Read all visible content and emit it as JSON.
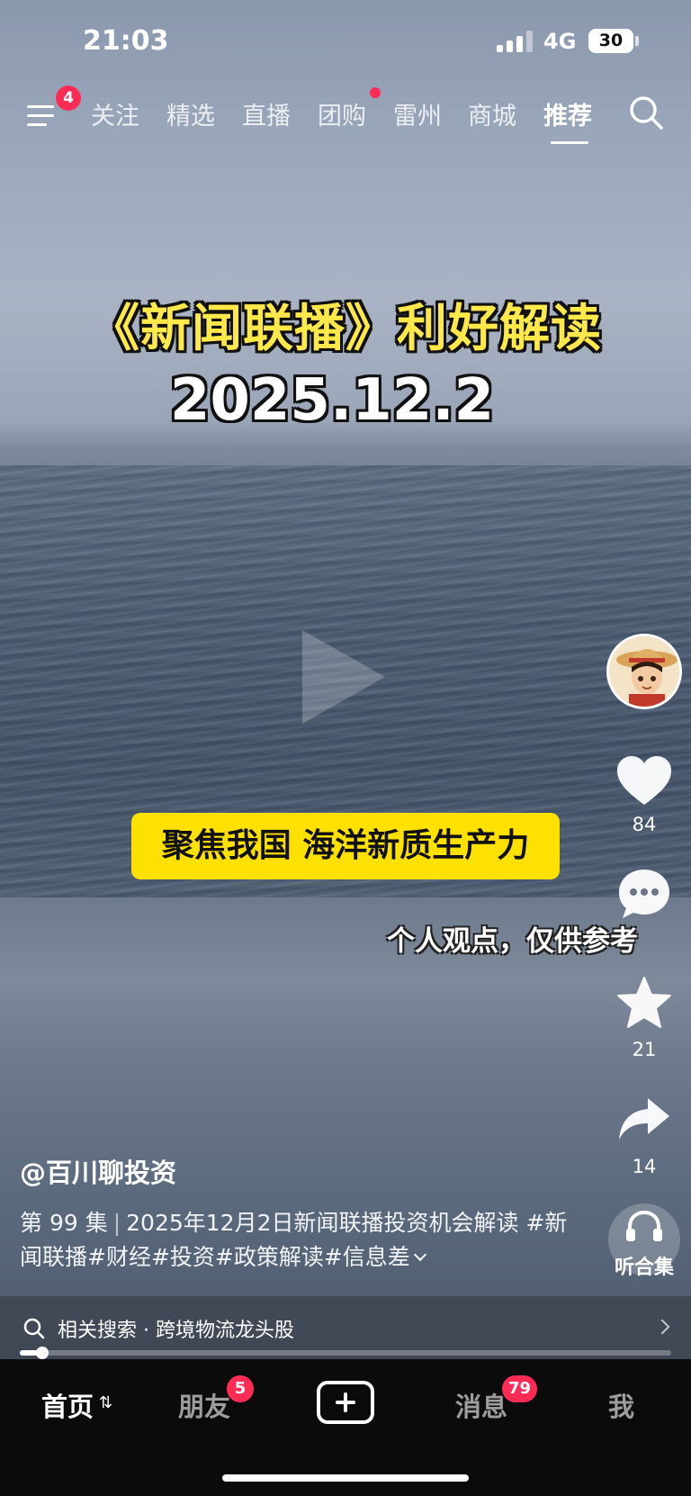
{
  "status_bar": {
    "time": "21:03",
    "network": "4G",
    "battery": "30"
  },
  "top_nav": {
    "menu_badge": "4",
    "tabs": [
      {
        "label": "关注"
      },
      {
        "label": "精选"
      },
      {
        "label": "直播"
      },
      {
        "label": "团购"
      },
      {
        "label": "雷州"
      },
      {
        "label": "商城"
      },
      {
        "label": "推荐"
      }
    ],
    "active_tab": "推荐",
    "dot_tab": "团购"
  },
  "video": {
    "title": "《新闻联播》利好解读",
    "date": "2025.12.2",
    "caption": "聚焦我国 海洋新质生产力",
    "disclaimer": "个人观点，仅供参考"
  },
  "actions": {
    "like_count": "84",
    "favorite_count": "21",
    "share_count": "14",
    "listen_label": "听合集"
  },
  "post": {
    "author": "@百川聊投资",
    "episode": "第 99 集",
    "description": "2025年12月2日新闻联播投资机会解读 #新闻联播#财经#投资#政策解读#信息差"
  },
  "related_search": {
    "text": "相关搜索 · 跨境物流龙头股"
  },
  "playback": {
    "progress": 0.035
  },
  "bottom_tabs": {
    "home": "首页",
    "friends": "朋友",
    "friends_badge": "5",
    "messages": "消息",
    "messages_badge": "79",
    "me": "我"
  },
  "colors": {
    "accent": "#fe2c55",
    "caption_bg": "#ffe100",
    "title_yellow": "#ffe94a"
  }
}
